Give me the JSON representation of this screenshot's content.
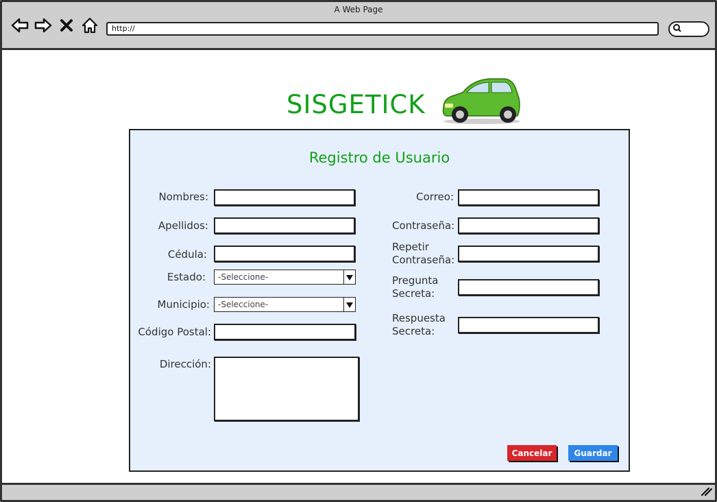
{
  "window": {
    "title": "A Web Page"
  },
  "browser": {
    "url": "http://"
  },
  "brand": {
    "name": "SISGETICK"
  },
  "form": {
    "title": "Registro de Usuario",
    "left": {
      "nombres_label": "Nombres:",
      "apellidos_label": "Apellidos:",
      "cedula_label": "Cédula:",
      "estado_label": "Estado:",
      "estado_value": "-Seleccione-",
      "municipio_label": "Municipio:",
      "municipio_value": "-Seleccione-",
      "codigo_postal_label": "Código Postal:",
      "direccion_label": "Dirección:"
    },
    "right": {
      "correo_label": "Correo:",
      "contrasena_label": "Contraseña:",
      "repetir_label_1": "Repetir",
      "repetir_label_2": "Contraseña:",
      "pregunta_label_1": "Pregunta",
      "pregunta_label_2": "Secreta:",
      "respuesta_label_1": "Respuesta",
      "respuesta_label_2": "Secreta:"
    },
    "buttons": {
      "cancel": "Cancelar",
      "save": "Guardar"
    }
  },
  "colors": {
    "brand_green": "#11a019",
    "panel_bg": "#e6f0fc",
    "cancel_red": "#d7262c",
    "save_blue": "#2f86e8"
  },
  "icons": [
    "back-arrow-icon",
    "forward-arrow-icon",
    "close-icon",
    "home-icon",
    "search-icon",
    "car-icon",
    "dropdown-arrow-icon",
    "resize-grip-icon"
  ]
}
